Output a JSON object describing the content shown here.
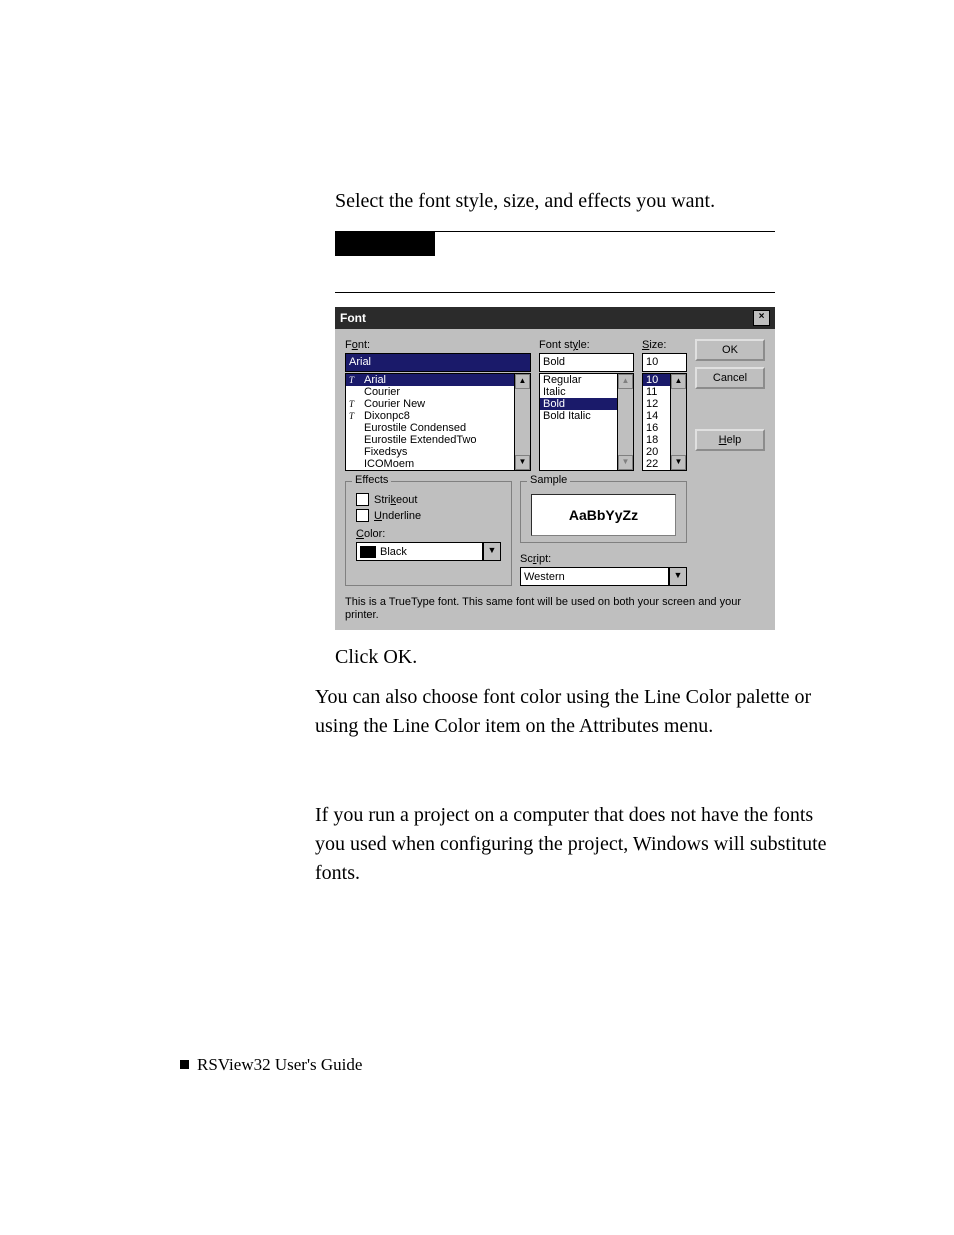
{
  "intro": "Select the font style, size, and effects you want.",
  "step3": "Click OK.",
  "para1": "You can also choose font color using the Line Color palette or using the Line Color item on the Attributes menu.",
  "para2": "If you run a project on a computer that does not have the fonts you used when configuring the project, Windows will substitute fonts.",
  "footer": "RSView32  User's Guide",
  "dialog": {
    "title": "Font",
    "font": {
      "label_pre": "F",
      "label_u": "o",
      "label_post": "nt:",
      "value": "Arial",
      "items": [
        {
          "tt": true,
          "name": "Arial",
          "sel": true
        },
        {
          "tt": false,
          "name": "Courier"
        },
        {
          "tt": true,
          "name": "Courier New"
        },
        {
          "tt": true,
          "name": "Dixonpc8"
        },
        {
          "tt": false,
          "name": "Eurostile Condensed"
        },
        {
          "tt": false,
          "name": "Eurostile ExtendedTwo"
        },
        {
          "tt": false,
          "name": "Fixedsys"
        },
        {
          "tt": false,
          "name": "ICOMoem"
        }
      ]
    },
    "style": {
      "label_pre": "Font st",
      "label_u": "y",
      "label_post": "le:",
      "value": "Bold",
      "items": [
        {
          "name": "Regular"
        },
        {
          "name": "Italic"
        },
        {
          "name": "Bold",
          "sel": true
        },
        {
          "name": "Bold Italic"
        }
      ]
    },
    "size": {
      "label_u": "S",
      "label_post": "ize:",
      "value": "10",
      "items": [
        "10",
        "11",
        "12",
        "14",
        "16",
        "18",
        "20",
        "22"
      ]
    },
    "buttons": {
      "ok": "OK",
      "cancel": "Cancel",
      "help_u": "H",
      "help_post": "elp"
    },
    "effects": {
      "legend": "Effects",
      "strike_pre": "Stri",
      "strike_u": "k",
      "strike_post": "eout",
      "und_u": "U",
      "und_post": "nderline",
      "color_u": "C",
      "color_post": "olor:",
      "color_val": "Black"
    },
    "sample": {
      "legend": "Sample",
      "text": "AaBbYyZz"
    },
    "script": {
      "label_pre": "Sc",
      "label_u": "r",
      "label_post": "ipt:",
      "value": "Western"
    },
    "note": "This is a TrueType font. This same font will be used on both your screen and your printer."
  }
}
